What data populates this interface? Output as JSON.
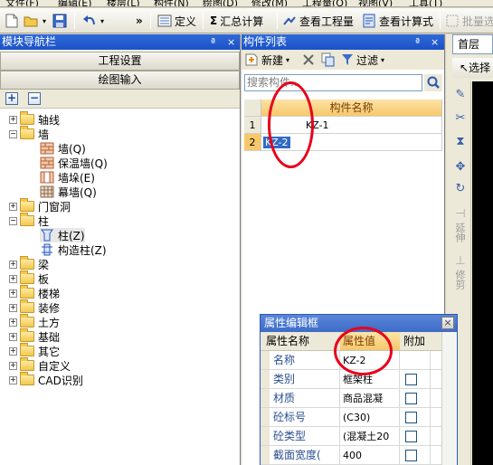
{
  "menubar": {
    "items": [
      "文件(F)",
      "编辑(E)",
      "楼层(L)",
      "构件(N)",
      "绘图(D)",
      "修改(M)",
      "工程量(Q)",
      "视图(V)",
      "工具(T)"
    ]
  },
  "toolbar": {
    "define_label": "定义",
    "sum_label": "汇总计算",
    "view_quantity_label": "查看工程量",
    "view_formula_label": "查看计算式",
    "batch_select_label": "批量选择",
    "more_label": "»"
  },
  "left_panel": {
    "title": "模块导航栏",
    "pin": "ª",
    "close": "×",
    "project_settings_label": "工程设置",
    "drawing_input_label": "绘图输入",
    "tree": [
      {
        "label": "轴线",
        "expander": "+",
        "level": 0,
        "type": "folder"
      },
      {
        "label": "墙",
        "expander": "−",
        "level": 0,
        "type": "folder-open"
      },
      {
        "label": "墙(Q)",
        "level": 1,
        "type": "wall"
      },
      {
        "label": "保温墙(Q)",
        "level": 1,
        "type": "wall"
      },
      {
        "label": "墙垛(E)",
        "level": 1,
        "type": "pier"
      },
      {
        "label": "幕墙(Q)",
        "level": 1,
        "type": "curtain"
      },
      {
        "label": "门窗洞",
        "expander": "+",
        "level": 0,
        "type": "folder"
      },
      {
        "label": "柱",
        "expander": "−",
        "level": 0,
        "type": "folder-open"
      },
      {
        "label": "柱(Z)",
        "level": 1,
        "type": "column",
        "selected": true
      },
      {
        "label": "构造柱(Z)",
        "level": 1,
        "type": "cons-column"
      },
      {
        "label": "梁",
        "expander": "+",
        "level": 0,
        "type": "folder"
      },
      {
        "label": "板",
        "expander": "+",
        "level": 0,
        "type": "folder"
      },
      {
        "label": "楼梯",
        "expander": "+",
        "level": 0,
        "type": "folder"
      },
      {
        "label": "装修",
        "expander": "+",
        "level": 0,
        "type": "folder"
      },
      {
        "label": "土方",
        "expander": "+",
        "level": 0,
        "type": "folder"
      },
      {
        "label": "基础",
        "expander": "+",
        "level": 0,
        "type": "folder"
      },
      {
        "label": "其它",
        "expander": "+",
        "level": 0,
        "type": "folder"
      },
      {
        "label": "自定义",
        "expander": "+",
        "level": 0,
        "type": "folder"
      },
      {
        "label": "CAD识别",
        "expander": "+",
        "level": 0,
        "type": "folder"
      }
    ]
  },
  "component_list": {
    "title": "构件列表",
    "new_label": "新建",
    "filter_label": "过滤",
    "search_placeholder": "搜索构件...",
    "column_header": "构件名称",
    "rows": [
      {
        "num": "1",
        "name": "KZ-1"
      },
      {
        "num": "2",
        "name": "KZ-2"
      }
    ]
  },
  "right": {
    "floor": "首层",
    "select_label": "选择",
    "extend_label": "延伸",
    "trim_label": "修剪"
  },
  "property_dialog": {
    "title": "属性编辑框",
    "headers": [
      "属性名称",
      "属性值",
      "附加"
    ],
    "rows": [
      {
        "name": "名称",
        "value": "KZ-2",
        "checkbox": false
      },
      {
        "name": "类别",
        "value": "框架柱",
        "checkbox": true
      },
      {
        "name": "材质",
        "value": "商品混凝",
        "checkbox": true
      },
      {
        "name": "砼标号",
        "value": "(C30)",
        "checkbox": true
      },
      {
        "name": "砼类型",
        "value": "(混凝土20",
        "checkbox": true
      },
      {
        "name": "截面宽度(",
        "value": "400",
        "checkbox": true
      }
    ]
  },
  "colors": {
    "title_blue": "#1b52c6",
    "highlight_orange": "#f6c86a",
    "annotation_red": "#e8001a",
    "selection_blue": "#316ac5"
  }
}
